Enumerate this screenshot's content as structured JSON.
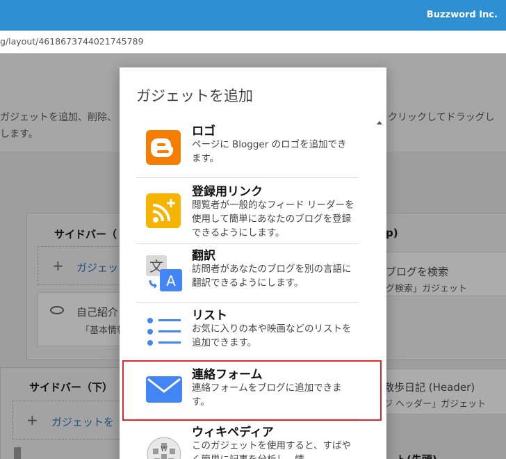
{
  "header": {
    "brand": "Buzzword Inc."
  },
  "address_bar": {
    "url": "g/layout/4618673744021745789"
  },
  "background": {
    "description_line1_left": "ガジェットを追加、削除、",
    "description_line1_right": "クリックしてドラッグし",
    "description_line2": "します。",
    "sidebar_top_title": "サイドバー（",
    "add_gadget_partial": "ガジェッ",
    "profile_title_partial": "自己紹介",
    "profile_sub_partial": "「基本情報",
    "right_top_title_partial": "p)",
    "blog_search_title": "ブログを検索",
    "blog_search_sub": "グ検索」ガジェット",
    "sidebar_bottom_title": "サイドバー（下）",
    "add_gadget_bottom": "ガジェットを",
    "header_gadget_title": "散歩日記 (Header)",
    "header_gadget_sub": "ジ ヘッダー」ガジェット",
    "bottom_partial": "ト(先頭)"
  },
  "dialog": {
    "title": "ガジェットを追加",
    "items": [
      {
        "title": "ロゴ",
        "desc": "ページに Blogger のロゴを追加できます。",
        "icon": "blogger-logo-icon"
      },
      {
        "title": "登録用リンク",
        "desc": "閲覧者が一般的なフィード リーダーを使用して簡単にあなたのブログを登録できるようにします。",
        "icon": "rss-feed-icon"
      },
      {
        "title": "翻訳",
        "desc": "訪問者があなたのブログを別の言語に翻訳できるようにします。",
        "icon": "translate-icon"
      },
      {
        "title": "リスト",
        "desc": "お気に入りの本や映画などのリストを追加できます。",
        "icon": "list-icon"
      },
      {
        "title": "連絡フォーム",
        "desc": "連絡フォームをブログに追加できます。",
        "icon": "envelope-icon"
      },
      {
        "title": "ウィキペディア",
        "desc": "このガジェットを使用すると、すばやく簡単に記事を分析し、情",
        "icon": "wikipedia-globe-icon"
      }
    ]
  },
  "colors": {
    "accent": "#2e8fd2",
    "highlight": "#e0262a",
    "blogger_orange": "#f57d00",
    "rss_yellow": "#f5b400",
    "list_blue": "#4285f4"
  }
}
